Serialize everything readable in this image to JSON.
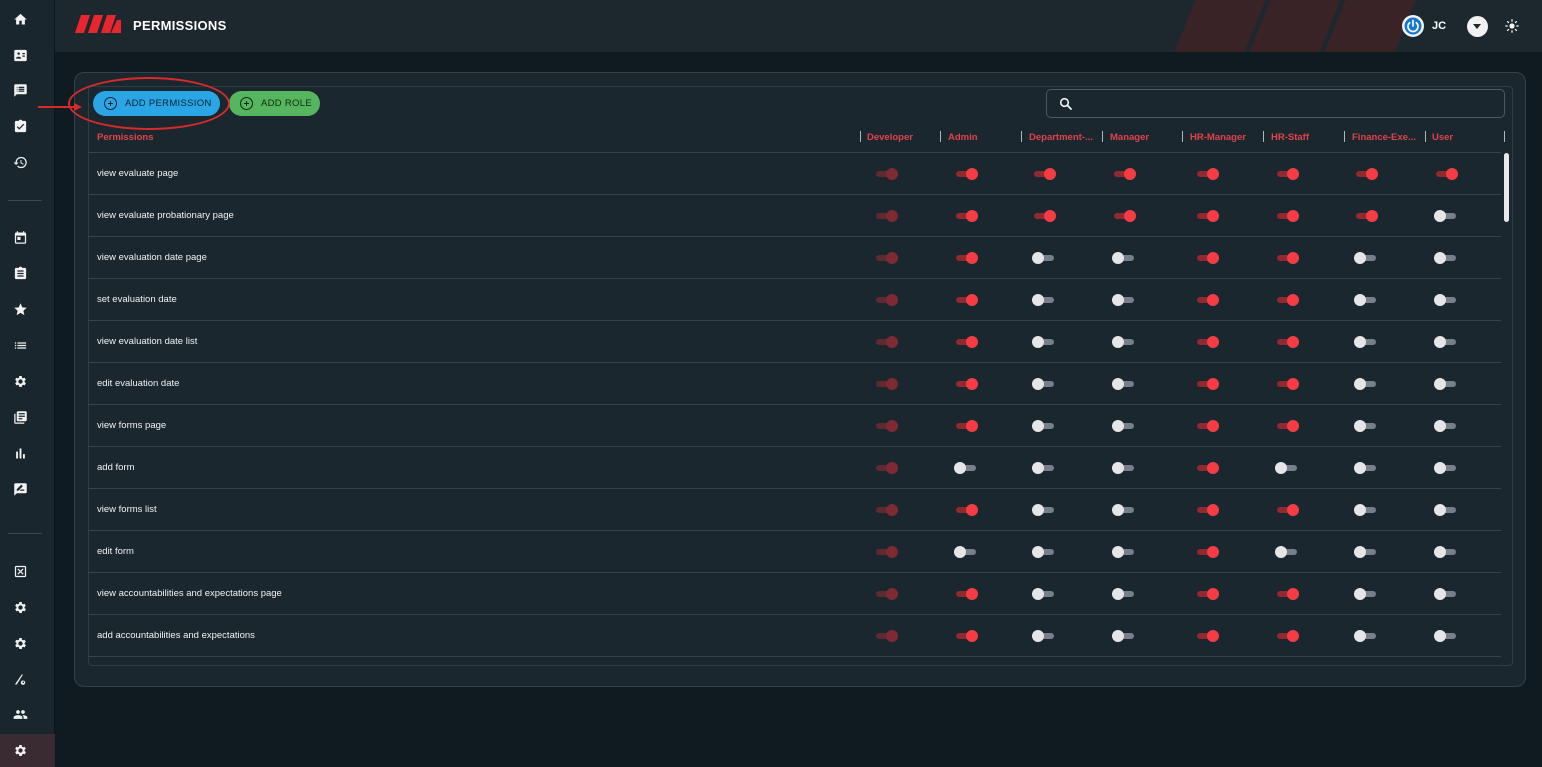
{
  "header": {
    "title": "PERMISSIONS",
    "user_initials": "JC"
  },
  "toolbar": {
    "add_permission_label": "ADD PERMISSION",
    "add_role_label": "ADD ROLE",
    "search_placeholder": ""
  },
  "table": {
    "first_column": "Permissions",
    "roles": [
      "Developer",
      "Admin",
      "Department-...",
      "Manager",
      "HR-Manager",
      "HR-Staff",
      "Finance-Exe...",
      "User"
    ],
    "rows": [
      {
        "name": "view evaluate page",
        "states": [
          "disabled",
          "on",
          "on",
          "on",
          "on",
          "on",
          "on",
          "on"
        ]
      },
      {
        "name": "view evaluate probationary page",
        "states": [
          "disabled",
          "on",
          "on",
          "on",
          "on",
          "on",
          "on",
          "off"
        ]
      },
      {
        "name": "view evaluation date page",
        "states": [
          "disabled",
          "on",
          "off",
          "off",
          "on",
          "on",
          "off",
          "off"
        ]
      },
      {
        "name": "set evaluation date",
        "states": [
          "disabled",
          "on",
          "off",
          "off",
          "on",
          "on",
          "off",
          "off"
        ]
      },
      {
        "name": "view evaluation date list",
        "states": [
          "disabled",
          "on",
          "off",
          "off",
          "on",
          "on",
          "off",
          "off"
        ]
      },
      {
        "name": "edit evaluation date",
        "states": [
          "disabled",
          "on",
          "off",
          "off",
          "on",
          "on",
          "off",
          "off"
        ]
      },
      {
        "name": "view forms page",
        "states": [
          "disabled",
          "on",
          "off",
          "off",
          "on",
          "on",
          "off",
          "off"
        ]
      },
      {
        "name": "add form",
        "states": [
          "disabled",
          "off",
          "off",
          "off",
          "on",
          "off",
          "off",
          "off"
        ]
      },
      {
        "name": "view forms list",
        "states": [
          "disabled",
          "on",
          "off",
          "off",
          "on",
          "on",
          "off",
          "off"
        ]
      },
      {
        "name": "edit form",
        "states": [
          "disabled",
          "off",
          "off",
          "off",
          "on",
          "off",
          "off",
          "off"
        ]
      },
      {
        "name": "view accountabilities and expectations page",
        "states": [
          "disabled",
          "on",
          "off",
          "off",
          "on",
          "on",
          "off",
          "off"
        ]
      },
      {
        "name": "add accountabilities and expectations",
        "states": [
          "disabled",
          "on",
          "off",
          "off",
          "on",
          "on",
          "off",
          "off"
        ]
      }
    ]
  },
  "sidebar": {
    "items": [
      {
        "icon": "home-icon"
      },
      {
        "icon": "id-card-icon"
      },
      {
        "icon": "feedback-icon"
      },
      {
        "icon": "clipboard-check-icon"
      },
      {
        "icon": "history-icon"
      },
      {
        "icon": "calendar-icon"
      },
      {
        "icon": "clipboard-icon"
      },
      {
        "icon": "star-icon"
      },
      {
        "icon": "list-icon"
      },
      {
        "icon": "gear-icon"
      },
      {
        "icon": "library-icon"
      },
      {
        "icon": "bar-chart-icon"
      },
      {
        "icon": "rate-review-icon"
      },
      {
        "icon": "cancel-box-icon"
      },
      {
        "icon": "gear-icon"
      },
      {
        "icon": "gear-icon"
      },
      {
        "icon": "road-settings-icon"
      },
      {
        "icon": "users-icon"
      },
      {
        "icon": "gear-icon"
      }
    ]
  },
  "colors": {
    "accent_red": "#f53c45",
    "primary_blue": "#2aa6e7",
    "success_green": "#55b65f",
    "background": "#101b21",
    "panel": "#1b272e"
  }
}
